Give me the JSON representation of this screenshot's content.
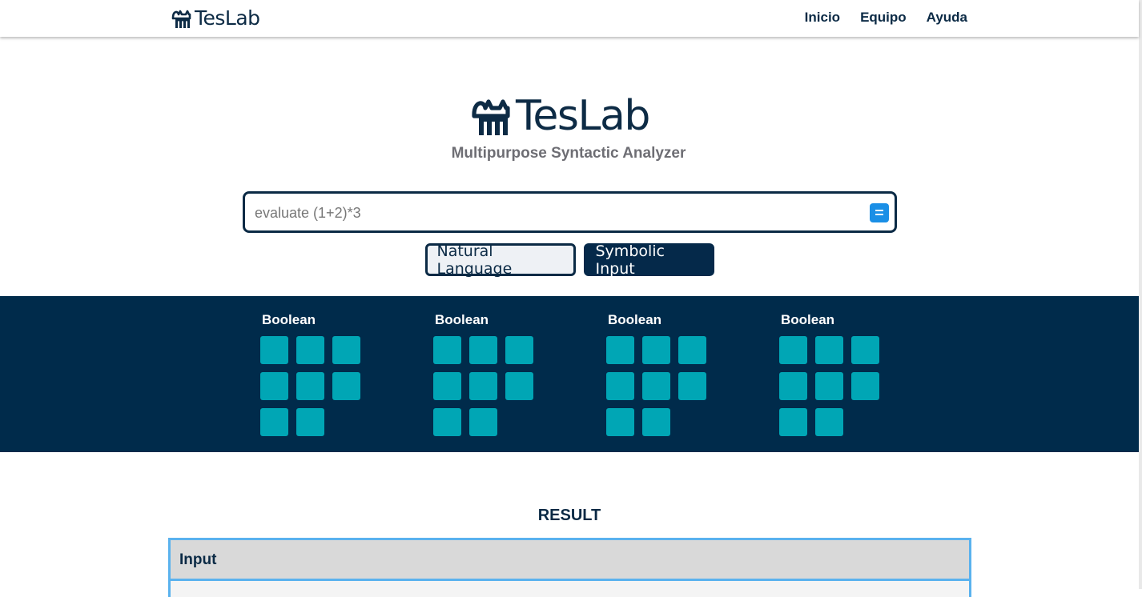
{
  "header": {
    "brand": "TesLab",
    "nav": [
      "Inicio",
      "Equipo",
      "Ayuda"
    ]
  },
  "hero": {
    "title": "TesLab",
    "subtitle": "Multipurpose Syntactic Analyzer"
  },
  "search": {
    "placeholder": "evaluate (1+2)*3",
    "value": "",
    "evaluate_icon": "equals-icon"
  },
  "modes": {
    "natural": "Natural Language",
    "symbolic": "Symbolic Input"
  },
  "categories": [
    {
      "title": "Boolean",
      "tiles": 8
    },
    {
      "title": "Boolean",
      "tiles": 8
    },
    {
      "title": "Boolean",
      "tiles": 8
    },
    {
      "title": "Boolean",
      "tiles": 8
    }
  ],
  "result": {
    "title": "RESULT",
    "input_label": "Input"
  },
  "colors": {
    "navy": "#002b4b",
    "tile": "#00a6b5",
    "accent_blue": "#1a8fe6",
    "table_border": "#5ab2ee",
    "subtitle_gray": "#6e6e74"
  }
}
